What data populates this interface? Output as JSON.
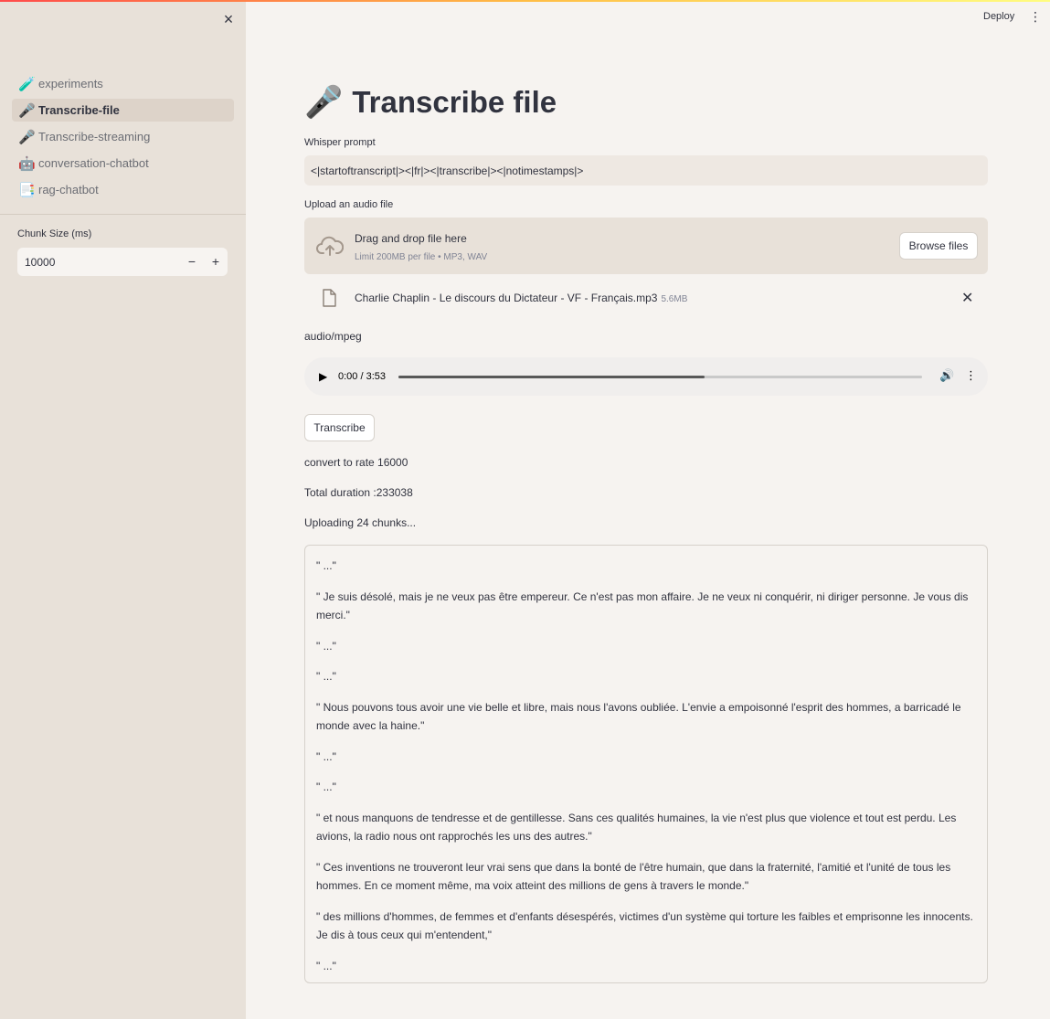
{
  "sidebar": {
    "close_icon": "×",
    "nav": [
      {
        "icon": "🧪",
        "label": "experiments",
        "active": false
      },
      {
        "icon": "🎤",
        "label": "Transcribe-file",
        "active": true
      },
      {
        "icon": "🎤",
        "label": "Transcribe-streaming",
        "active": false
      },
      {
        "icon": "🤖",
        "label": "conversation-chatbot",
        "active": false
      },
      {
        "icon": "📑",
        "label": "rag-chatbot",
        "active": false
      }
    ],
    "chunk_label": "Chunk Size (ms)",
    "chunk_value": "10000",
    "minus": "−",
    "plus": "+"
  },
  "header": {
    "deploy": "Deploy",
    "menu_icon": "⋮"
  },
  "main": {
    "title_icon": "🎤",
    "title": "Transcribe file",
    "prompt_label": "Whisper prompt",
    "prompt_value": "<|startoftranscript|><|fr|><|transcribe|><|notimestamps|>",
    "upload_label": "Upload an audio file",
    "drag_text": "Drag and drop file here",
    "limit_text": "Limit 200MB per file • MP3, WAV",
    "browse_label": "Browse files",
    "file_name": "Charlie Chaplin - Le discours du Dictateur - VF - Français.mp3",
    "file_size": "5.6MB",
    "file_close": "✕",
    "mime": "audio/mpeg",
    "audio": {
      "time": "0:00 / 3:53",
      "progress": 0.585
    },
    "transcribe_label": "Transcribe",
    "status_lines": [
      "convert to rate 16000",
      "Total duration :233038",
      "Uploading 24 chunks..."
    ],
    "output_lines": [
      "\" ...\"",
      "\" Je suis désolé, mais je ne veux pas être empereur. Ce n'est pas mon affaire. Je ne veux ni conquérir, ni diriger personne. Je vous dis merci.\"",
      "\" ...\"",
      "\" ...\"",
      "\" Nous pouvons tous avoir une vie belle et libre, mais nous l'avons oubliée. L'envie a empoisonné l'esprit des hommes, a barricadé le monde avec la haine.\"",
      "\" ...\"",
      "\" ...\"",
      "\" et nous manquons de tendresse et de gentillesse. Sans ces qualités humaines, la vie n'est plus que violence et tout est perdu. Les avions, la radio nous ont rapprochés les uns des autres.\"",
      "\" Ces inventions ne trouveront leur vrai sens que dans la bonté de l'être humain, que dans la fraternité, l'amitié et l'unité de tous les hommes. En ce moment même, ma voix atteint des millions de gens à travers le monde.\"",
      "\" des millions d'hommes, de femmes et d'enfants désespérés, victimes d'un système qui torture les faibles et emprisonne les innocents. Je dis à tous ceux qui m'entendent,\"",
      "\" ...\""
    ]
  }
}
